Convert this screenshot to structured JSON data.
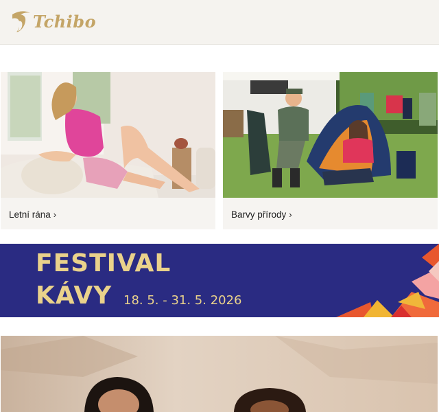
{
  "header": {
    "brand": "Tchibo",
    "logo_icon": "tchibo-cup-logo-icon"
  },
  "cards": [
    {
      "label": "Letní rána",
      "chevron": "›",
      "image": "woman-relaxing-on-sofa-photo"
    },
    {
      "label": "Barvy přírody",
      "chevron": "›",
      "image": "couple-camping-tent-photo"
    }
  ],
  "banner": {
    "line1": "FESTIVAL",
    "line2": "KÁVY",
    "dates": "18. 5. - 31. 5. 2026",
    "colors": {
      "background": "#2a2b82",
      "text": "#ead28b"
    }
  },
  "promo": {
    "image": "two-people-portrait-photo"
  },
  "colors": {
    "brand_gold": "#c4a567",
    "header_bg": "#f5f3ef",
    "card_bg": "#f6f4f1"
  }
}
